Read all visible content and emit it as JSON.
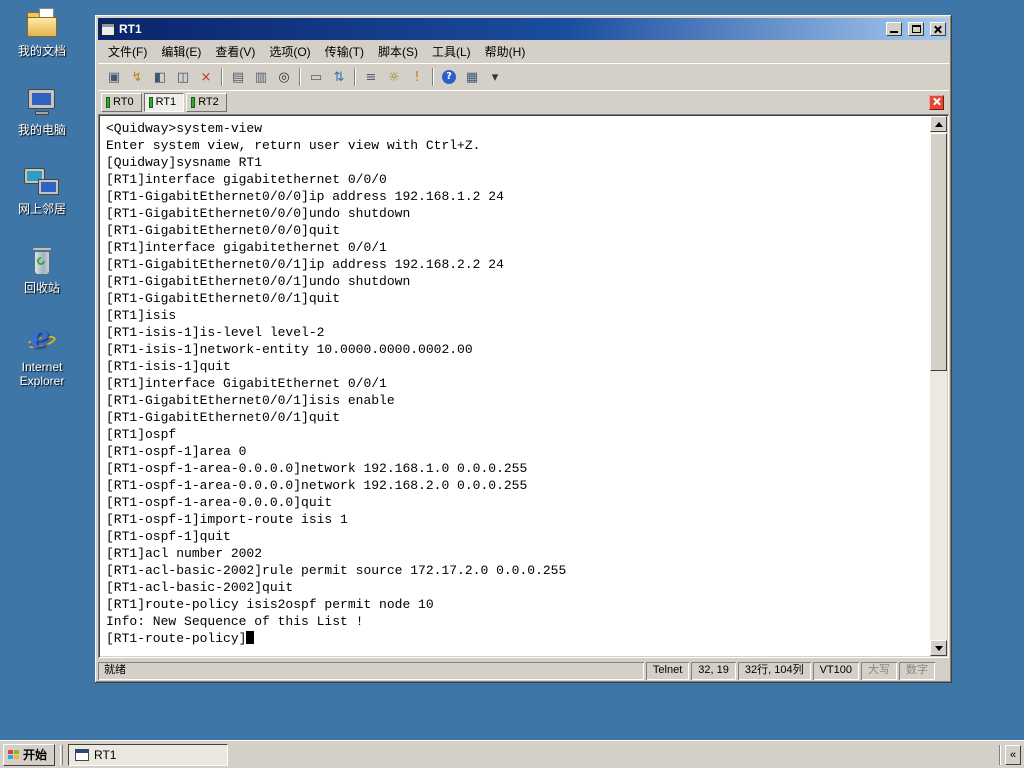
{
  "colors": {
    "desktop_bg": "#3F76A8",
    "titlebar_start": "#0A246A",
    "titlebar_end": "#A6CAF0",
    "tab_connected_led": "#33A833",
    "tab_close_red": "#E04838",
    "terminal_bg": "#FFFFFF",
    "terminal_fg": "#000000"
  },
  "desktop": {
    "icons": [
      {
        "id": "my-documents",
        "icon": "my-documents-icon",
        "label": "我的文档"
      },
      {
        "id": "my-computer",
        "icon": "my-computer-icon",
        "label": "我的电脑"
      },
      {
        "id": "network-places",
        "icon": "network-places-icon",
        "label": "网上邻居"
      },
      {
        "id": "recycle-bin",
        "icon": "recycle-bin-icon",
        "label": "回收站"
      },
      {
        "id": "internet-explorer",
        "icon": "internet-explorer-icon",
        "label": "Internet Explorer"
      }
    ]
  },
  "window": {
    "title": "RT1",
    "menus": [
      "文件(F)",
      "编辑(E)",
      "查看(V)",
      "选项(O)",
      "传输(T)",
      "脚本(S)",
      "工具(L)",
      "帮助(H)"
    ],
    "toolbar": [
      {
        "name": "connect-icon",
        "glyph": "▣",
        "color": "#3E5A74"
      },
      {
        "name": "quick-connect-icon",
        "glyph": "↯",
        "color": "#C08018"
      },
      {
        "name": "connect-in-tab-icon",
        "glyph": "◧",
        "color": "#3E5A74"
      },
      {
        "name": "reconnect-icon",
        "glyph": "◫",
        "color": "#3E5A74"
      },
      {
        "name": "disconnect-icon",
        "glyph": "×",
        "color": "#C23227"
      },
      {
        "type": "sep"
      },
      {
        "name": "copy-icon",
        "glyph": "▤",
        "color": "#55606B"
      },
      {
        "name": "paste-icon",
        "glyph": "▥",
        "color": "#55606B"
      },
      {
        "name": "find-icon",
        "glyph": "◎",
        "color": "#333333"
      },
      {
        "type": "sep"
      },
      {
        "name": "print-icon",
        "glyph": "▭",
        "color": "#55606B"
      },
      {
        "name": "transfer-icon",
        "glyph": "⇅",
        "color": "#2F6FB0"
      },
      {
        "type": "sep"
      },
      {
        "name": "keymap-icon",
        "glyph": "≡",
        "color": "#55606B"
      },
      {
        "name": "session-options-icon",
        "glyph": "☼",
        "color": "#8A7A18"
      },
      {
        "name": "run-script-icon",
        "glyph": "!",
        "color": "#D07818"
      },
      {
        "type": "sep"
      },
      {
        "name": "help-icon",
        "glyph": "?",
        "color": "#FFFFFF",
        "bg": "#2B5FC7"
      },
      {
        "name": "properties-icon",
        "glyph": "▦",
        "color": "#3E5A74"
      },
      {
        "name": "toolbar-overflow-icon",
        "glyph": "▾",
        "color": "#333333"
      }
    ],
    "tabs": [
      {
        "label": "RT0",
        "active": false
      },
      {
        "label": "RT1",
        "active": true
      },
      {
        "label": "RT2",
        "active": false
      }
    ],
    "terminal_lines": [
      "<Quidway>system-view",
      "Enter system view, return user view with Ctrl+Z.",
      "[Quidway]sysname RT1",
      "[RT1]interface gigabitethernet 0/0/0",
      "[RT1-GigabitEthernet0/0/0]ip address 192.168.1.2 24",
      "[RT1-GigabitEthernet0/0/0]undo shutdown",
      "[RT1-GigabitEthernet0/0/0]quit",
      "[RT1]interface gigabitethernet 0/0/1",
      "[RT1-GigabitEthernet0/0/1]ip address 192.168.2.2 24",
      "[RT1-GigabitEthernet0/0/1]undo shutdown",
      "[RT1-GigabitEthernet0/0/1]quit",
      "[RT1]isis",
      "[RT1-isis-1]is-level level-2",
      "[RT1-isis-1]network-entity 10.0000.0000.0002.00",
      "[RT1-isis-1]quit",
      "[RT1]interface GigabitEthernet 0/0/1",
      "[RT1-GigabitEthernet0/0/1]isis enable",
      "[RT1-GigabitEthernet0/0/1]quit",
      "[RT1]ospf",
      "[RT1-ospf-1]area 0",
      "[RT1-ospf-1-area-0.0.0.0]network 192.168.1.0 0.0.0.255",
      "[RT1-ospf-1-area-0.0.0.0]network 192.168.2.0 0.0.0.255",
      "[RT1-ospf-1-area-0.0.0.0]quit",
      "[RT1-ospf-1]import-route isis 1",
      "[RT1-ospf-1]quit",
      "[RT1]acl number 2002",
      "[RT1-acl-basic-2002]rule permit source 172.17.2.0 0.0.0.255",
      "[RT1-acl-basic-2002]quit",
      "[RT1]route-policy isis2ospf permit node 10",
      "Info: New Sequence of this List !",
      "[RT1-route-policy]"
    ],
    "status": {
      "ready": "就绪",
      "protocol": "Telnet",
      "cursor_pos": "32, 19",
      "screen_size": "32行, 104列",
      "emulation": "VT100",
      "caps_label": "大写",
      "num_label": "数字"
    }
  },
  "taskbar": {
    "start_label": "开始",
    "tasks": [
      {
        "label": "RT1",
        "active": true
      }
    ],
    "tray_chevron": "«"
  }
}
